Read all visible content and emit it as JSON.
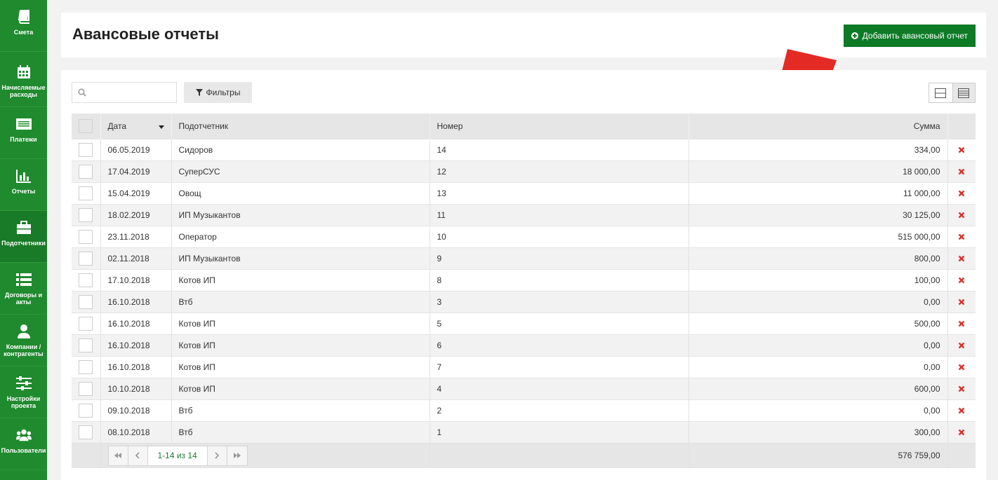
{
  "sidebar": {
    "items": [
      {
        "label": "Смета",
        "icon": "book-icon"
      },
      {
        "label": "Начисляемые расходы",
        "icon": "calendar-icon"
      },
      {
        "label": "Платежи",
        "icon": "payments-icon"
      },
      {
        "label": "Отчеты",
        "icon": "bar-chart-icon"
      },
      {
        "label": "Подотчетники",
        "icon": "briefcase-icon"
      },
      {
        "label": "Договоры и акты",
        "icon": "list-icon"
      },
      {
        "label": "Компании / контрагенты",
        "icon": "user-icon"
      },
      {
        "label": "Настройки проекта",
        "icon": "sliders-icon"
      },
      {
        "label": "Пользователи",
        "icon": "users-icon"
      }
    ]
  },
  "header": {
    "title": "Авансовые отчеты",
    "add_label": "Добавить авансовый отчет"
  },
  "toolbar": {
    "search_placeholder": "",
    "filter_label": "Фильтры"
  },
  "table": {
    "columns": {
      "date": "Дата",
      "person": "Подотчетник",
      "number": "Номер",
      "sum": "Сумма"
    },
    "rows": [
      {
        "date": "06.05.2019",
        "person": "Сидоров",
        "number": "14",
        "sum": "334,00"
      },
      {
        "date": "17.04.2019",
        "person": "СуперСУС",
        "number": "12",
        "sum": "18 000,00"
      },
      {
        "date": "15.04.2019",
        "person": "Овощ",
        "number": "13",
        "sum": "11 000,00"
      },
      {
        "date": "18.02.2019",
        "person": "ИП Музыкантов",
        "number": "11",
        "sum": "30 125,00"
      },
      {
        "date": "23.11.2018",
        "person": "Оператор",
        "number": "10",
        "sum": "515 000,00"
      },
      {
        "date": "02.11.2018",
        "person": "ИП Музыкантов",
        "number": "9",
        "sum": "800,00"
      },
      {
        "date": "17.10.2018",
        "person": "Котов ИП",
        "number": "8",
        "sum": "100,00"
      },
      {
        "date": "16.10.2018",
        "person": "Втб",
        "number": "3",
        "sum": "0,00"
      },
      {
        "date": "16.10.2018",
        "person": "Котов ИП",
        "number": "5",
        "sum": "500,00"
      },
      {
        "date": "16.10.2018",
        "person": "Котов ИП",
        "number": "6",
        "sum": "0,00"
      },
      {
        "date": "16.10.2018",
        "person": "Котов ИП",
        "number": "7",
        "sum": "0,00"
      },
      {
        "date": "10.10.2018",
        "person": "Котов ИП",
        "number": "4",
        "sum": "600,00"
      },
      {
        "date": "09.10.2018",
        "person": "Втб",
        "number": "2",
        "sum": "0,00"
      },
      {
        "date": "08.10.2018",
        "person": "Втб",
        "number": "1",
        "sum": "300,00"
      }
    ],
    "footer": {
      "page_info": "1-14 из 14",
      "total": "576 759,00"
    }
  },
  "colors": {
    "sidebar": "#1f8a2e",
    "primary_button": "#0d7a26",
    "delete": "#d9342b",
    "arrow_decoration": "#e42a24"
  }
}
